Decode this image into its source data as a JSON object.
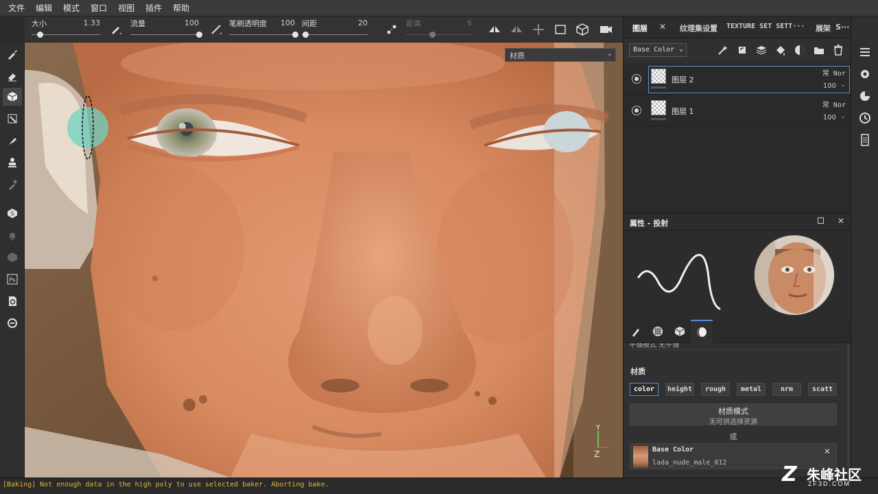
{
  "menu": [
    "文件",
    "编辑",
    "模式",
    "窗口",
    "视图",
    "插件",
    "帮助"
  ],
  "options_bar": {
    "size": {
      "label": "大小",
      "value": "1.33",
      "level": 0.12
    },
    "flow": {
      "label": "流量",
      "value": "100",
      "level": 1.0
    },
    "stroke_opacity": {
      "label": "笔刷透明度",
      "value": "100",
      "level": 1.0
    },
    "spacing": {
      "label": "间距",
      "value": "20",
      "level": 0.05
    },
    "distance": {
      "label": "距离",
      "value": "6",
      "level": 0.4
    }
  },
  "viewport": {
    "material_mode": "材质",
    "axis": {
      "y": "Y",
      "z": "Z"
    }
  },
  "right_panel": {
    "tabs": {
      "layers": "图层",
      "texture_set_settings": "纹理集设置",
      "texture_set_settings_en": "TEXTURE SET SETT···",
      "shelf": "展架",
      "s_tab": "S···"
    },
    "channel": "Base Color",
    "layers": [
      {
        "name": "图层 2",
        "blend": "常 Nor",
        "opacity": "100",
        "selected": true
      },
      {
        "name": "图层 1",
        "blend": "常 Nor",
        "opacity": "100",
        "selected": false
      }
    ],
    "properties": {
      "title": "属性 - 投射",
      "cut_row": "平铺模式    无平铺",
      "material_title": "材质",
      "channels": [
        "color",
        "height",
        "rough",
        "metal",
        "nrm",
        "scatt"
      ],
      "active_channel": "color",
      "material_mode_title": "材质模式",
      "material_mode_sub": "无可供选择资源",
      "or": "或",
      "base_color_title": "Base Color",
      "base_color_resource": "lada_nude_male_012"
    }
  },
  "status": "[Baking] Not enough data in the high poly to use selected baker. Aborting bake.",
  "watermark": {
    "logo": "Z",
    "name": "朱峰社区",
    "domain": "ZF3D.COM"
  }
}
